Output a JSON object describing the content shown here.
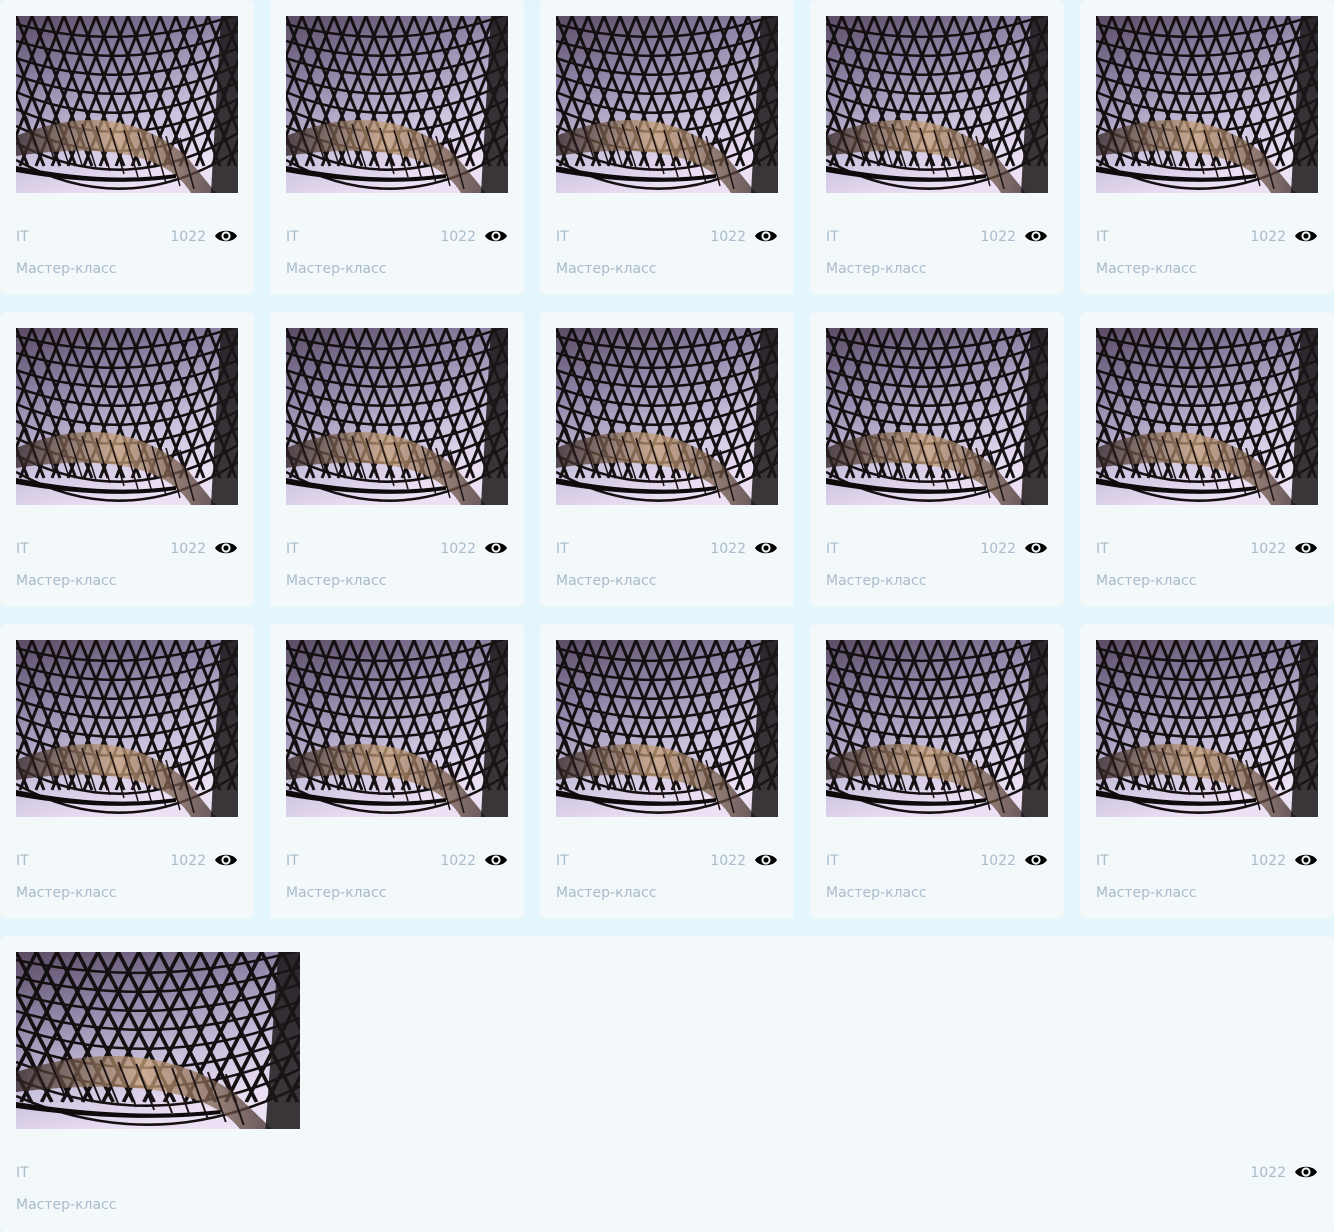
{
  "cards": [
    {
      "category": "IT",
      "views": "1022",
      "type": "Мастер-класс",
      "thumbnail": "architecture-lattice-roof-photo",
      "view_icon": "eye-icon"
    },
    {
      "category": "IT",
      "views": "1022",
      "type": "Мастер-класс",
      "thumbnail": "architecture-lattice-roof-photo",
      "view_icon": "eye-icon"
    },
    {
      "category": "IT",
      "views": "1022",
      "type": "Мастер-класс",
      "thumbnail": "architecture-lattice-roof-photo",
      "view_icon": "eye-icon"
    },
    {
      "category": "IT",
      "views": "1022",
      "type": "Мастер-класс",
      "thumbnail": "architecture-lattice-roof-photo",
      "view_icon": "eye-icon"
    },
    {
      "category": "IT",
      "views": "1022",
      "type": "Мастер-класс",
      "thumbnail": "architecture-lattice-roof-photo",
      "view_icon": "eye-icon"
    },
    {
      "category": "IT",
      "views": "1022",
      "type": "Мастер-класс",
      "thumbnail": "architecture-lattice-roof-photo",
      "view_icon": "eye-icon"
    },
    {
      "category": "IT",
      "views": "1022",
      "type": "Мастер-класс",
      "thumbnail": "architecture-lattice-roof-photo",
      "view_icon": "eye-icon"
    },
    {
      "category": "IT",
      "views": "1022",
      "type": "Мастер-класс",
      "thumbnail": "architecture-lattice-roof-photo",
      "view_icon": "eye-icon"
    },
    {
      "category": "IT",
      "views": "1022",
      "type": "Мастер-класс",
      "thumbnail": "architecture-lattice-roof-photo",
      "view_icon": "eye-icon"
    },
    {
      "category": "IT",
      "views": "1022",
      "type": "Мастер-класс",
      "thumbnail": "architecture-lattice-roof-photo",
      "view_icon": "eye-icon"
    },
    {
      "category": "IT",
      "views": "1022",
      "type": "Мастер-класс",
      "thumbnail": "architecture-lattice-roof-photo",
      "view_icon": "eye-icon"
    },
    {
      "category": "IT",
      "views": "1022",
      "type": "Мастер-класс",
      "thumbnail": "architecture-lattice-roof-photo",
      "view_icon": "eye-icon"
    },
    {
      "category": "IT",
      "views": "1022",
      "type": "Мастер-класс",
      "thumbnail": "architecture-lattice-roof-photo",
      "view_icon": "eye-icon"
    },
    {
      "category": "IT",
      "views": "1022",
      "type": "Мастер-класс",
      "thumbnail": "architecture-lattice-roof-photo",
      "view_icon": "eye-icon"
    },
    {
      "category": "IT",
      "views": "1022",
      "type": "Мастер-класс",
      "thumbnail": "architecture-lattice-roof-photo",
      "view_icon": "eye-icon"
    },
    {
      "category": "IT",
      "views": "1022",
      "type": "Мастер-класс",
      "thumbnail": "architecture-lattice-roof-photo",
      "view_icon": "eye-icon"
    }
  ],
  "colors": {
    "page_background": "#e3f6fd",
    "card_background": "#f3f8fa",
    "meta_text": "#a9bccb",
    "icon": "#000000"
  }
}
